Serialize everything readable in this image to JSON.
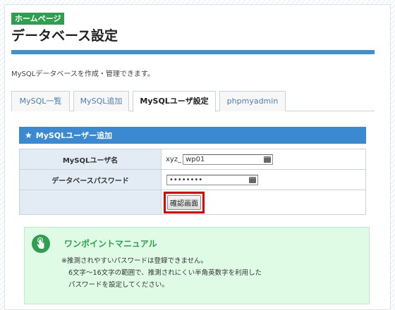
{
  "header": {
    "badge": "ホームページ",
    "title": "データベース設定",
    "description": "MySQLデータベースを作成・管理できます。"
  },
  "tabs": [
    {
      "label": "MySQL一覧",
      "active": false
    },
    {
      "label": "MySQL追加",
      "active": false
    },
    {
      "label": "MySQLユーザ設定",
      "active": true
    },
    {
      "label": "phpmyadmin",
      "active": false
    }
  ],
  "section": {
    "star_icon": "★",
    "title": "MySQLユーザー追加"
  },
  "form": {
    "username_label": "MySQLユーザ名",
    "username_prefix": "xyz_",
    "username_value": "wp01",
    "password_label": "データベースパスワード",
    "password_value": "••••••••",
    "confirm_button": "確認画面"
  },
  "manual": {
    "title": "ワンポイントマニュアル",
    "lines": [
      "※推測されやすいパスワードは登録できません。",
      "6文字〜16文字の範囲で、推測されにくい半角英数字を利用した",
      "パスワードを設定してください。"
    ]
  },
  "colors": {
    "accent_blue": "#3b8ad1",
    "badge_green": "#2e9e4f",
    "highlight_red": "#e00000",
    "manual_bg": "#dffbe6"
  }
}
